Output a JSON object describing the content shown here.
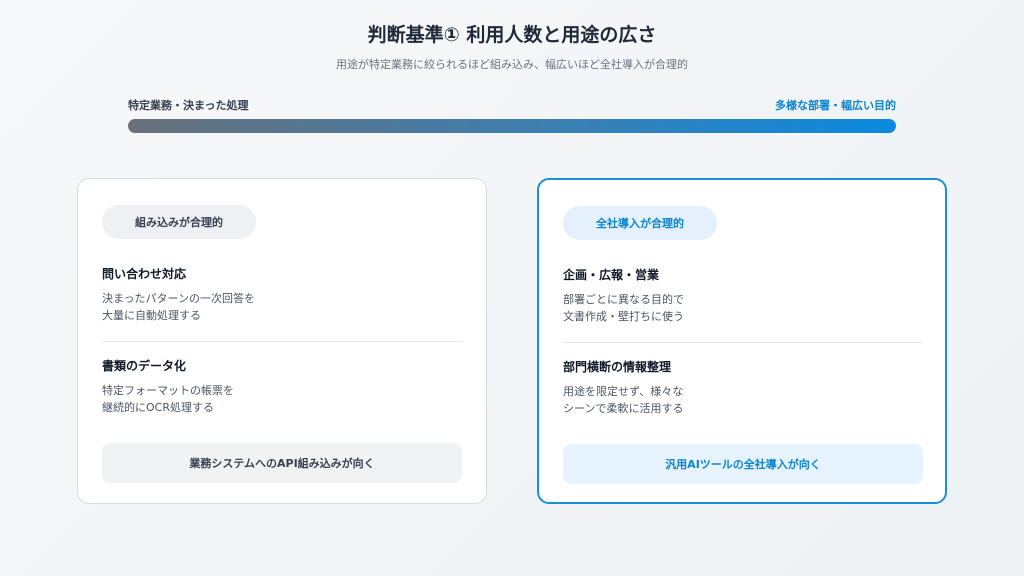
{
  "header": {
    "title": "判断基準① 利用人数と用途の広さ",
    "subtitle": "用途が特定業務に絞られるほど組み込み、幅広いほど全社導入が合理的"
  },
  "scale": {
    "left_label": "特定業務・決まった処理",
    "right_label": "多様な部署・幅広い目的"
  },
  "cards": {
    "left": {
      "pill": "組み込みが合理的",
      "items": [
        {
          "title": "問い合わせ対応",
          "desc": [
            "決まったパターンの一次回答を",
            "大量に自動処理する"
          ]
        },
        {
          "title": "書類のデータ化",
          "desc": [
            "特定フォーマットの帳票を",
            "継続的にOCR処理する"
          ]
        }
      ],
      "footer": "業務システムへのAPI組み込みが向く"
    },
    "right": {
      "pill": "全社導入が合理的",
      "items": [
        {
          "title": "企画・広報・営業",
          "desc": [
            "部署ごとに異なる目的で",
            "文書作成・壁打ちに使う"
          ]
        },
        {
          "title": "部門横断の情報整理",
          "desc": [
            "用途を限定せず、様々な",
            "シーンで柔軟に活用する"
          ]
        }
      ],
      "footer": "汎用AIツールの全社導入が向く"
    }
  },
  "colors": {
    "accent": "#0b84d1",
    "neutral": "#374151"
  }
}
